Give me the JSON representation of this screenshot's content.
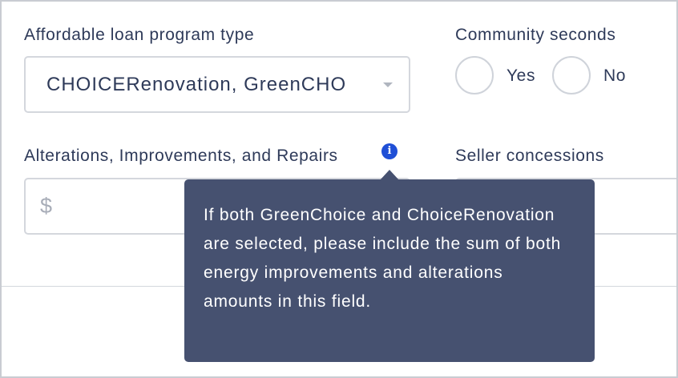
{
  "loan_program": {
    "label": "Affordable loan program type",
    "selected_value": "CHOICERenovation, GreenCHO"
  },
  "community_seconds": {
    "label": "Community seconds",
    "options": [
      {
        "label": "Yes"
      },
      {
        "label": "No"
      }
    ]
  },
  "alterations": {
    "label": "Alterations, Improvements, and Repairs",
    "currency_symbol": "$",
    "info_icon_glyph": "i"
  },
  "seller_concessions": {
    "label": "Seller concessions"
  },
  "tooltip": {
    "text": "If both GreenChoice and ChoiceRenovation are selected, please include the sum of both energy improvements and alterations amounts in this field."
  },
  "colors": {
    "text": "#2e3a59",
    "tooltip_bg": "#465170",
    "info_icon": "#1f4fd6",
    "border": "#d4d7dd"
  }
}
